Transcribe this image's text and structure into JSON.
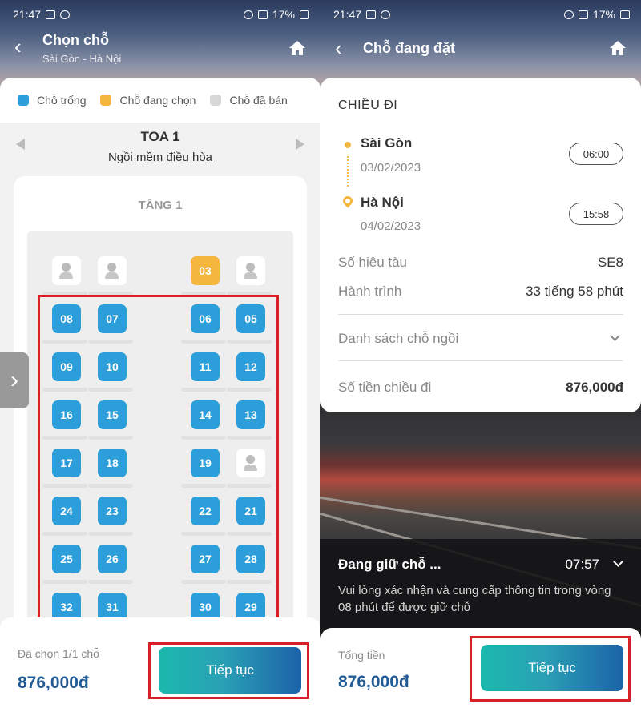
{
  "status_bar": {
    "time": "21:47",
    "battery": "17%"
  },
  "left": {
    "header": {
      "title": "Chọn chỗ",
      "subtitle": "Sài Gòn - Hà Nội"
    },
    "legend": [
      {
        "label": "Chỗ trống",
        "color": "#2c9fdb"
      },
      {
        "label": "Chỗ đang chọn",
        "color": "#f4b63c"
      },
      {
        "label": "Chỗ đã bán",
        "color": "#d8d8d8"
      }
    ],
    "coach": {
      "title": "TOA 1",
      "subtitle": "Ngồi mềm điều hòa"
    },
    "deck_title": "TẦNG 1",
    "seat_rows": [
      [
        "sold",
        "sold",
        "03",
        "sold"
      ],
      [
        "08",
        "07",
        "06",
        "05"
      ],
      [
        "09",
        "10",
        "11",
        "12"
      ],
      [
        "16",
        "15",
        "14",
        "13"
      ],
      [
        "17",
        "18",
        "19",
        "sold"
      ],
      [
        "24",
        "23",
        "22",
        "21"
      ],
      [
        "25",
        "26",
        "27",
        "28"
      ],
      [
        "32",
        "31",
        "30",
        "29"
      ]
    ],
    "selected_seat": "03",
    "side_tab_icon": "›",
    "footer": {
      "label": "Đã chọn 1/1 chỗ",
      "price": "876,000đ",
      "button": "Tiếp tục"
    }
  },
  "right": {
    "header": {
      "title": "Chỗ đang đặt"
    },
    "section_title": "CHIỀU ĐI",
    "origin": {
      "city": "Sài Gòn",
      "date": "03/02/2023",
      "time": "06:00"
    },
    "destination": {
      "city": "Hà Nội",
      "date": "04/02/2023",
      "time": "15:58"
    },
    "train_label": "Số hiệu tàu",
    "train_value": "SE8",
    "duration_label": "Hành trình",
    "duration_value": "33 tiếng 58 phút",
    "seat_list_label": "Danh sách chỗ ngồi",
    "amount_label": "Số tiền chiều đi",
    "amount_value": "876,000đ",
    "hold": {
      "title": "Đang giữ chỗ ...",
      "countdown": "07:57",
      "message": "Vui lòng xác nhận và cung cấp thông tin trong vòng 08 phút để được giữ chỗ"
    },
    "footer": {
      "label": "Tổng tiền",
      "price": "876,000đ",
      "button": "Tiếp tục"
    }
  }
}
